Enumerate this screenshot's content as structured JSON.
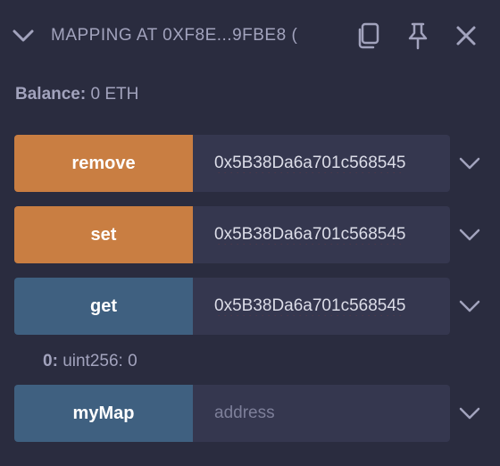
{
  "header": {
    "title": "MAPPING AT 0XF8E...9FBE8 (",
    "icons": [
      "chevron-down-icon",
      "copy-icon",
      "pin-icon",
      "close-icon"
    ]
  },
  "balance": {
    "label": "Balance:",
    "value": "0 ETH"
  },
  "functions": [
    {
      "label": "remove",
      "input_value": "0x5B38Da6a701c568545",
      "color": "#c97e42"
    },
    {
      "label": "set",
      "input_value": "0x5B38Da6a701c568545",
      "color": "#c97e42"
    },
    {
      "label": "get",
      "input_value": "0x5B38Da6a701c568545",
      "color": "#3f6080"
    },
    {
      "label": "myMap",
      "input_placeholder": "address",
      "color": "#3f6080"
    }
  ],
  "result": {
    "index": "0:",
    "value": "uint256: 0"
  },
  "colors": {
    "background": "#2a2c3f",
    "input": "#35374f",
    "transact": "#c97e42",
    "call": "#3f6080"
  }
}
